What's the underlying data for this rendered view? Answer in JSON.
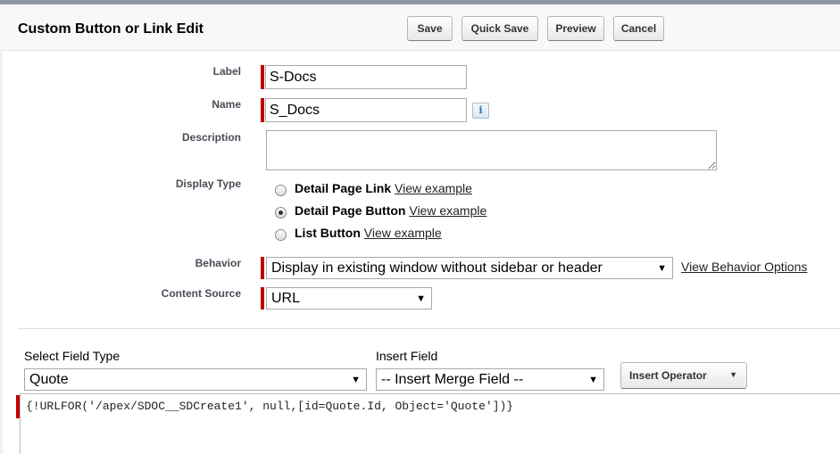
{
  "header": {
    "title": "Custom Button or Link Edit",
    "buttons": {
      "save": "Save",
      "quick_save": "Quick Save",
      "preview": "Preview",
      "cancel": "Cancel"
    }
  },
  "form": {
    "label": {
      "label": "Label",
      "value": "S-Docs"
    },
    "name": {
      "label": "Name",
      "value": "S_Docs",
      "info": "i"
    },
    "description": {
      "label": "Description",
      "value": ""
    },
    "display_type": {
      "label": "Display Type",
      "options": [
        {
          "name": "Detail Page Link",
          "link": "View example",
          "selected": false
        },
        {
          "name": "Detail Page Button",
          "link": "View example",
          "selected": true
        },
        {
          "name": "List Button",
          "link": "View example",
          "selected": false
        }
      ]
    },
    "behavior": {
      "label": "Behavior",
      "value": "Display in existing window without sidebar or header",
      "link": "View Behavior Options"
    },
    "content_source": {
      "label": "Content Source",
      "value": "URL"
    }
  },
  "formula_bar": {
    "field_type": {
      "label": "Select Field Type",
      "value": "Quote"
    },
    "insert_field": {
      "label": "Insert Field",
      "value": "-- Insert Merge Field --"
    },
    "insert_operator": "Insert Operator",
    "formula": "{!URLFOR('/apex/SDOC__SDCreate1', null,[id=Quote.Id, Object='Quote'])}"
  },
  "icons": {
    "dropdown": "▼",
    "radio_selected": "radio-selected",
    "info": "info-icon"
  },
  "colors": {
    "required": "#c00000",
    "topline": "#8e98a4"
  }
}
